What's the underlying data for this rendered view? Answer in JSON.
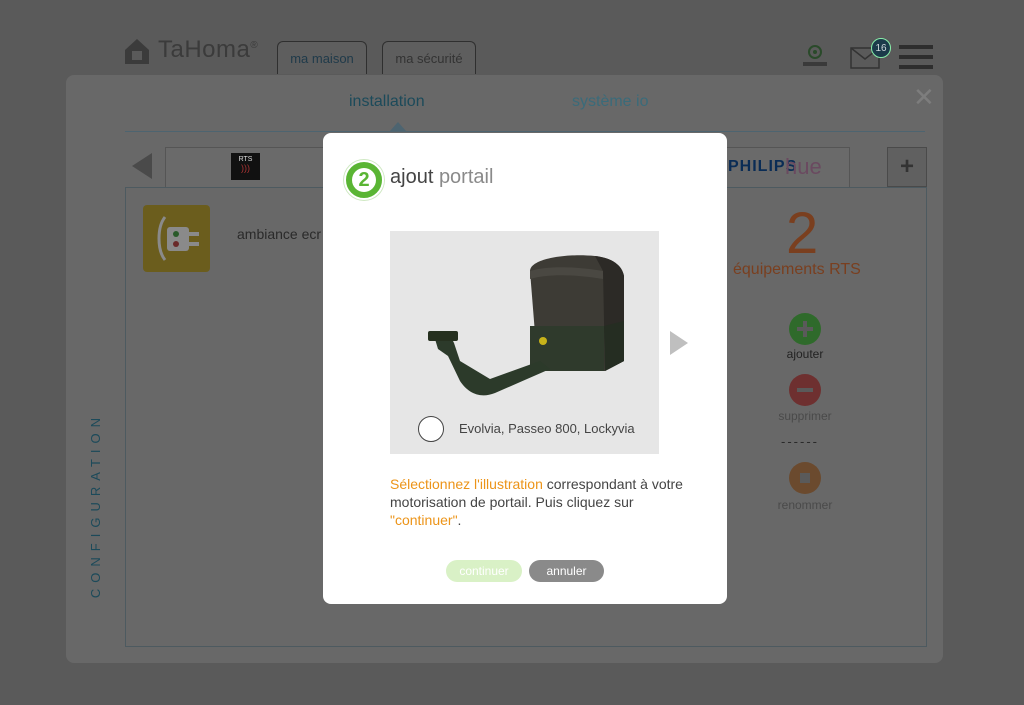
{
  "header": {
    "logo_text": "TaHoma",
    "logo_mark": "®",
    "tabs": [
      {
        "label": "ma maison"
      },
      {
        "label": "ma sécurité"
      }
    ],
    "notification_count": "16"
  },
  "panel": {
    "tabs": [
      {
        "label": "installation"
      },
      {
        "label": "système io"
      }
    ],
    "brands": {
      "rts": "RTS",
      "philips": "PHILIPS",
      "hue": "hue"
    },
    "device_label": "ambiance ecr",
    "side_label": "CONFIGURATION",
    "count": "2",
    "count_label": "équipements RTS",
    "actions": {
      "add": "ajouter",
      "delete": "supprimer",
      "separator": "------",
      "rename": "renommer"
    }
  },
  "modal": {
    "step": "2",
    "title_main": "ajout",
    "title_sub": "portail",
    "option_label": "Evolvia, Passeo 800, Lockyvia",
    "desc_highlight": "Sélectionnez l'illustration",
    "desc_text": " correspondant à votre motorisation de portail. Puis cliquez sur ",
    "desc_quote": "\"continuer\"",
    "desc_end": ".",
    "continue_label": "continuer",
    "cancel_label": "annuler"
  },
  "colors": {
    "accent_green": "#5ab534",
    "accent_orange": "#ec9419",
    "teal_text": "#1c4a5a"
  }
}
